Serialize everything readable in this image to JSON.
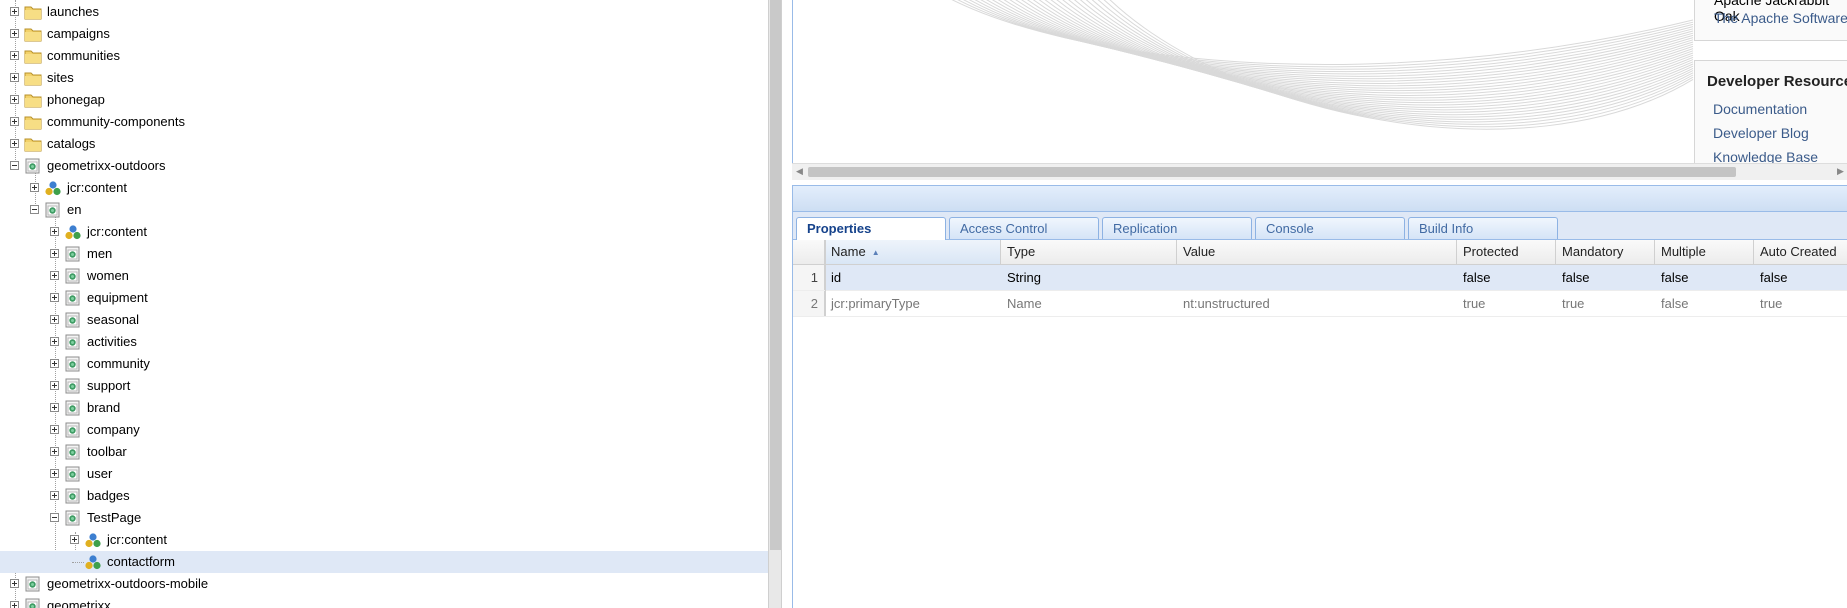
{
  "tree": {
    "nodes": [
      {
        "label": "launches",
        "icon": "folder",
        "expander": "plus",
        "selected": false
      },
      {
        "label": "campaigns",
        "icon": "folder",
        "expander": "plus",
        "selected": false
      },
      {
        "label": "communities",
        "icon": "folder",
        "expander": "plus",
        "selected": false
      },
      {
        "label": "sites",
        "icon": "folder",
        "expander": "plus",
        "selected": false
      },
      {
        "label": "phonegap",
        "icon": "folder",
        "expander": "plus",
        "selected": false
      },
      {
        "label": "community-components",
        "icon": "folder",
        "expander": "plus",
        "selected": false
      },
      {
        "label": "catalogs",
        "icon": "folder",
        "expander": "plus",
        "selected": false
      },
      {
        "label": "geometrixx-outdoors",
        "icon": "page",
        "expander": "minus",
        "selected": false
      },
      {
        "label": "jcr:content",
        "icon": "content-node",
        "expander": "plus",
        "selected": false
      },
      {
        "label": "en",
        "icon": "page",
        "expander": "minus",
        "selected": false
      },
      {
        "label": "jcr:content",
        "icon": "content-node",
        "expander": "plus",
        "selected": false
      },
      {
        "label": "men",
        "icon": "page",
        "expander": "plus",
        "selected": false
      },
      {
        "label": "women",
        "icon": "page",
        "expander": "plus",
        "selected": false
      },
      {
        "label": "equipment",
        "icon": "page",
        "expander": "plus",
        "selected": false
      },
      {
        "label": "seasonal",
        "icon": "page",
        "expander": "plus",
        "selected": false
      },
      {
        "label": "activities",
        "icon": "page",
        "expander": "plus",
        "selected": false
      },
      {
        "label": "community",
        "icon": "page",
        "expander": "plus",
        "selected": false
      },
      {
        "label": "support",
        "icon": "page",
        "expander": "plus",
        "selected": false
      },
      {
        "label": "brand",
        "icon": "page",
        "expander": "plus",
        "selected": false
      },
      {
        "label": "company",
        "icon": "page",
        "expander": "plus",
        "selected": false
      },
      {
        "label": "toolbar",
        "icon": "page",
        "expander": "plus",
        "selected": false
      },
      {
        "label": "user",
        "icon": "page",
        "expander": "plus",
        "selected": false
      },
      {
        "label": "badges",
        "icon": "page",
        "expander": "plus",
        "selected": false
      },
      {
        "label": "TestPage",
        "icon": "page",
        "expander": "minus",
        "selected": false
      },
      {
        "label": "jcr:content",
        "icon": "content-node",
        "expander": "plus",
        "selected": false
      },
      {
        "label": "contactform",
        "icon": "content-node",
        "expander": "none",
        "selected": true
      },
      {
        "label": "geometrixx-outdoors-mobile",
        "icon": "page",
        "expander": "plus",
        "selected": false
      },
      {
        "label": "geometrixx",
        "icon": "page",
        "expander": "plus",
        "selected": false
      }
    ]
  },
  "welcome": {
    "ext_line_1": "Apache Jackrabbit Oak",
    "ext_line_2": "The Apache Software",
    "dev_title": "Developer Resources",
    "dev_links": [
      "Documentation",
      "Developer Blog",
      "Knowledge Base"
    ]
  },
  "tabs": [
    {
      "label": "Properties",
      "active": true
    },
    {
      "label": "Access Control",
      "active": false
    },
    {
      "label": "Replication",
      "active": false
    },
    {
      "label": "Console",
      "active": false
    },
    {
      "label": "Build Info",
      "active": false
    }
  ],
  "grid": {
    "columns": [
      "Name",
      "Type",
      "Value",
      "Protected",
      "Mandatory",
      "Multiple",
      "Auto Created"
    ],
    "sorted_column": "Name",
    "rows": [
      {
        "num": "1",
        "cells": [
          "id",
          "String",
          "",
          "false",
          "false",
          "false",
          "false"
        ],
        "selected": true
      },
      {
        "num": "2",
        "cells": [
          "jcr:primaryType",
          "Name",
          "nt:unstructured",
          "true",
          "true",
          "false",
          "true"
        ],
        "selected": false
      }
    ]
  },
  "colors": {
    "selection": "#dfe8f6",
    "tab_text": "#416aa3",
    "active_tab_text": "#15428b",
    "panel_border": "#99bbe8",
    "link": "#3b5b8a"
  }
}
